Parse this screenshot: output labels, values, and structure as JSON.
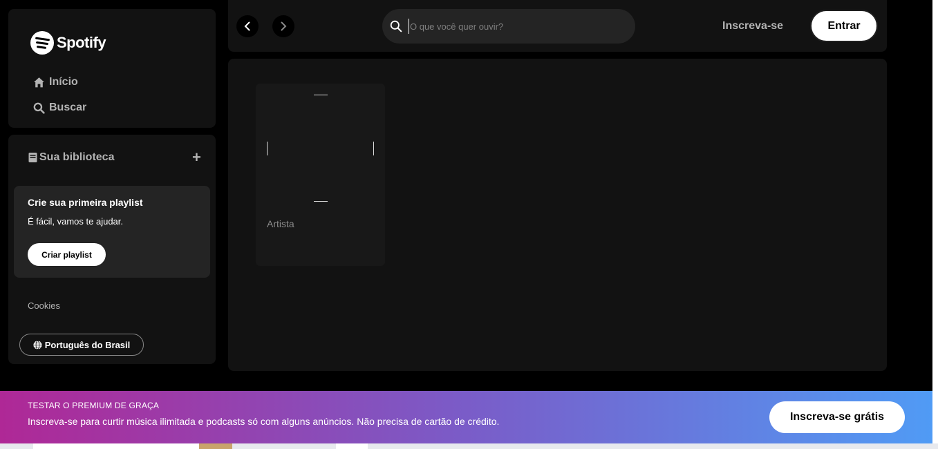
{
  "brand": {
    "name": "Spotify",
    "icon": "spotify-logo-icon"
  },
  "sidebar": {
    "nav": [
      {
        "label": "Início",
        "icon": "home-icon"
      },
      {
        "label": "Buscar",
        "icon": "search-icon"
      }
    ],
    "library": {
      "title": "Sua biblioteca",
      "icon": "library-icon",
      "add_label": "+"
    },
    "playlist_prompt": {
      "title": "Crie sua primeira playlist",
      "subtitle": "É fácil, vamos te ajudar.",
      "button": "Criar playlist"
    },
    "cookies_label": "Cookies",
    "language_label": "Português do Brasil"
  },
  "topbar": {
    "search_placeholder": "O que você quer ouvir?",
    "signup_label": "Inscreva-se",
    "login_label": "Entrar"
  },
  "main": {
    "cards": [
      {
        "subtitle": "Artista"
      }
    ]
  },
  "banner": {
    "title": "TESTAR O PREMIUM DE GRAÇA",
    "text": "Inscreva-se para curtir música ilimitada e podcasts só com alguns anúncios. Não precisa de cartão de crédito.",
    "button": "Inscreva-se grátis"
  },
  "colors": {
    "background": "#000000",
    "panel": "#121212",
    "card": "#242424",
    "banner_start": "#af2896",
    "banner_end": "#509bf5"
  }
}
